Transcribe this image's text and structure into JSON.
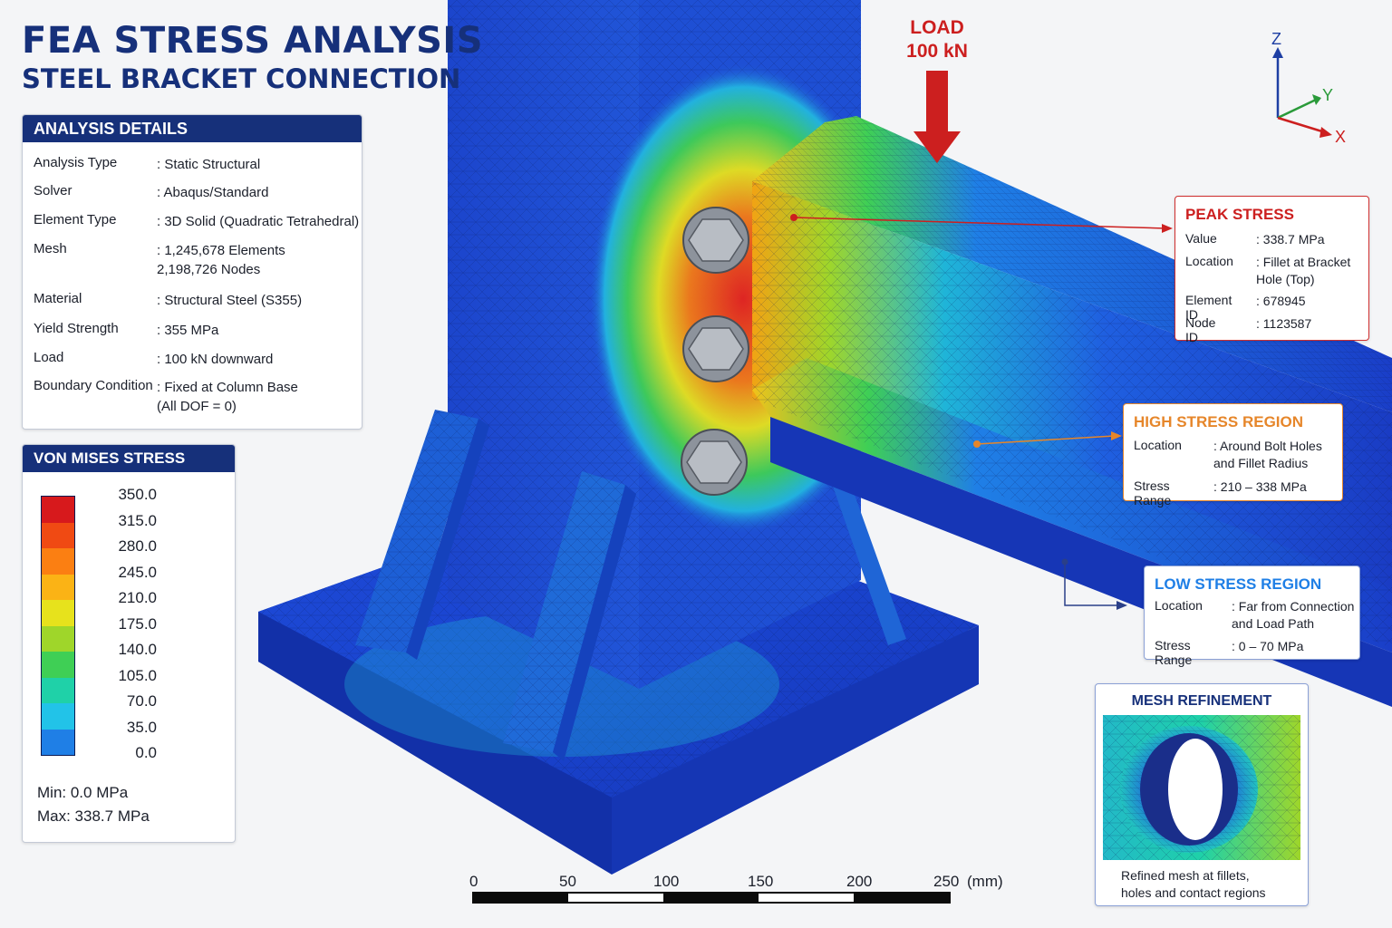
{
  "header": {
    "title": "FEA STRESS ANALYSIS",
    "subtitle": "STEEL BRACKET CONNECTION"
  },
  "details": {
    "heading": "ANALYSIS DETAILS",
    "rows": [
      {
        "label": "Analysis Type",
        "value": ": Static Structural"
      },
      {
        "label": "Solver",
        "value": ": Abaqus/Standard"
      },
      {
        "label": "Element Type",
        "value": ": 3D Solid (Quadratic Tetrahedral)"
      },
      {
        "label": "Mesh",
        "value": ": 1,245,678 Elements\n  2,198,726 Nodes"
      },
      {
        "label": "Material",
        "value": ": Structural Steel (S355)"
      },
      {
        "label": "Yield Strength",
        "value": ": 355 MPa"
      },
      {
        "label": "Load",
        "value": ": 100 kN downward"
      },
      {
        "label": "Boundary Condition",
        "value": ": Fixed at Column Base\n  (All DOF = 0)"
      }
    ]
  },
  "legend": {
    "heading": "VON MISES STRESS (MPa)",
    "ticks": [
      "350.0",
      "315.0",
      "280.0",
      "245.0",
      "210.0",
      "175.0",
      "140.0",
      "105.0",
      "70.0",
      "35.0",
      "0.0"
    ],
    "colors": [
      "#d7191c",
      "#f04a13",
      "#fb7f12",
      "#fbb315",
      "#e7e21c",
      "#9fd62a",
      "#3fcf55",
      "#1fd1a8",
      "#22c3e8",
      "#1f7fe6",
      "#1531c8"
    ],
    "min": "Min:  0.0 MPa",
    "max": "Max:  338.7 MPa"
  },
  "load": {
    "line1": "LOAD",
    "line2": "100 kN",
    "color": "#cc1f1f"
  },
  "axes": {
    "z": "Z",
    "y": "Y",
    "x": "X"
  },
  "peak": {
    "title": "PEAK STRESS",
    "rows": [
      {
        "label": "Value",
        "value": ": 338.7 MPa"
      },
      {
        "label": "Location",
        "value": ": Fillet at Bracket\n  Hole (Top)"
      },
      {
        "label": "Element ID",
        "value": ": 678945"
      },
      {
        "label": "Node ID",
        "value": ": 1123587"
      }
    ]
  },
  "high": {
    "title": "HIGH STRESS REGION",
    "rows": [
      {
        "label": "Location",
        "value": ": Around Bolt Holes\n  and Fillet Radius"
      },
      {
        "label": "Stress Range",
        "value": ": 210 – 338 MPa"
      }
    ]
  },
  "low": {
    "title": "LOW STRESS REGION",
    "rows": [
      {
        "label": "Location",
        "value": ": Far from Connection\n  and Load Path"
      },
      {
        "label": "Stress Range",
        "value": ": 0 – 70 MPa"
      }
    ]
  },
  "mesh": {
    "title": "MESH REFINEMENT",
    "caption": "Refined mesh at fillets,\nholes and contact regions"
  },
  "scale": {
    "labels": [
      "0",
      "50",
      "100",
      "150",
      "200",
      "250"
    ],
    "unit": "(mm)"
  }
}
